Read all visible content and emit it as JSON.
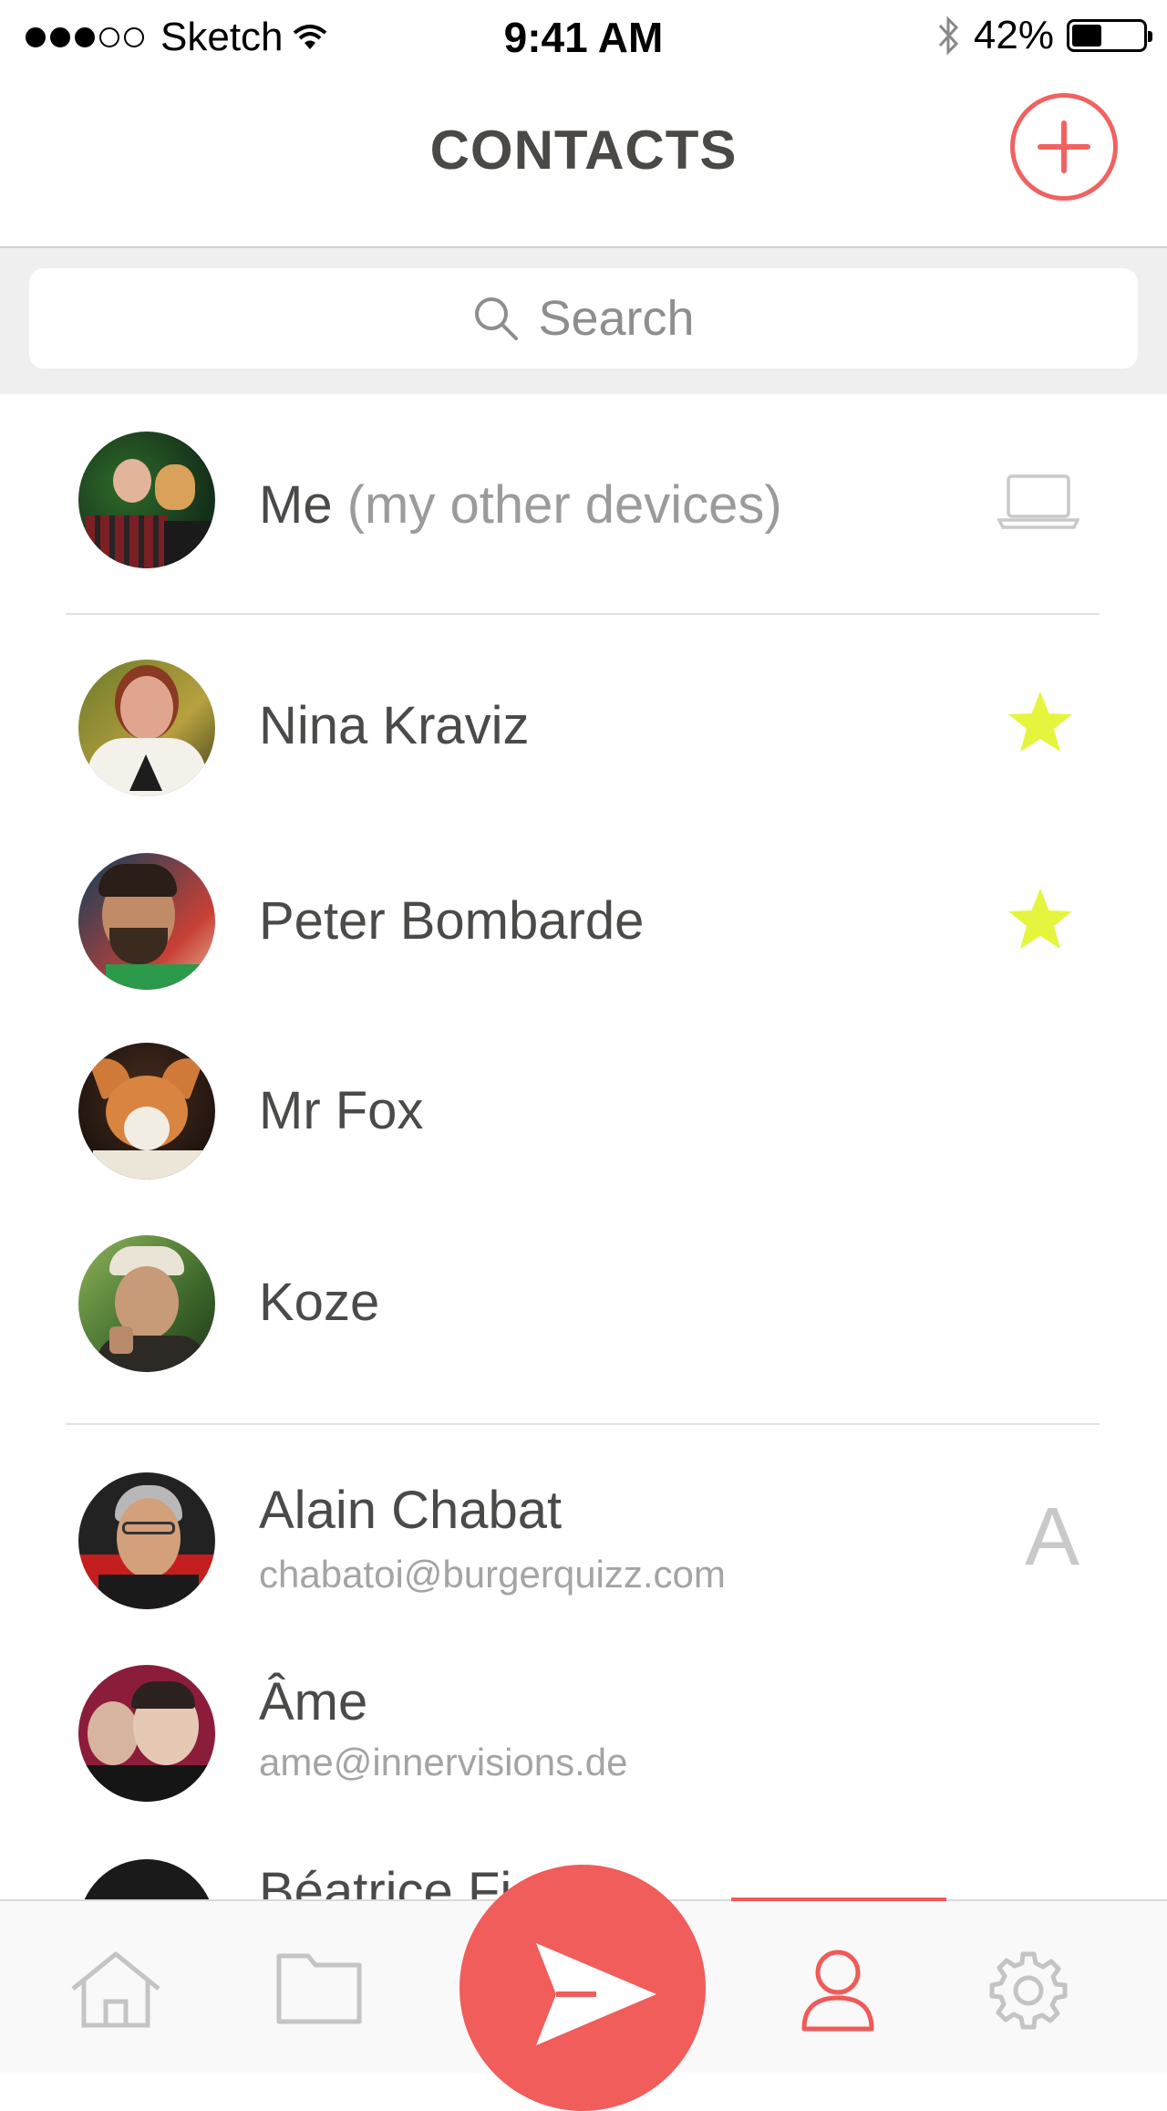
{
  "status_bar": {
    "carrier": "Sketch",
    "time": "9:41 AM",
    "battery": "42%",
    "battery_level": 0.42,
    "signal_bars_filled": 3,
    "signal_bars_total": 5
  },
  "header": {
    "title": "CONTACTS"
  },
  "search": {
    "placeholder": "Search"
  },
  "me": {
    "name": "Me",
    "note": "(my other devices)",
    "icon": "laptop-icon"
  },
  "favorites": [
    {
      "name": "Nina Kraviz",
      "favorite": true
    },
    {
      "name": "Peter Bombarde",
      "favorite": true
    },
    {
      "name": "Mr Fox",
      "favorite": false
    },
    {
      "name": "Koze",
      "favorite": false
    }
  ],
  "section_letter": "A",
  "contacts": [
    {
      "name": "Alain Chabat",
      "email": "chabatoi@burgerquizz.com"
    },
    {
      "name": "Âme",
      "email": "ame@innervisions.de"
    },
    {
      "name": "Béatrice Fi"
    }
  ],
  "tabs": {
    "items": [
      "home-icon",
      "folder-icon",
      "send-icon",
      "contacts-icon",
      "settings-icon"
    ],
    "active": "contacts-icon"
  },
  "colors": {
    "accent": "#f05d5b",
    "star": "#e5f53d",
    "title": "#4a4945",
    "muted": "#9b9b9b"
  }
}
